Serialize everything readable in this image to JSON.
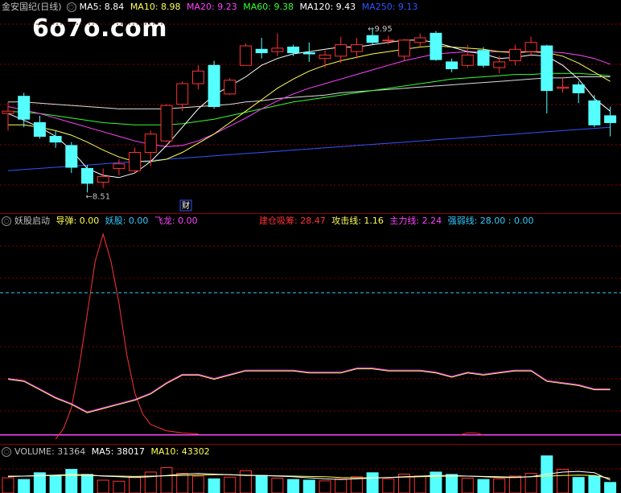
{
  "watermark": "6o7o.com",
  "main_legend": {
    "stock": "金安国纪(日线)",
    "items": [
      {
        "label": "MA5: 8.84",
        "color": "#ffffff"
      },
      {
        "label": "MA10: 8.98",
        "color": "#ffff55"
      },
      {
        "label": "MA20: 9.23",
        "color": "#ff44ff"
      },
      {
        "label": "MA60: 9.38",
        "color": "#33ff33"
      },
      {
        "label": "MA120: 9.43",
        "color": "#ffffff"
      },
      {
        "label": "MA250: 9.13",
        "color": "#3355ff"
      }
    ]
  },
  "annotations": {
    "high": "9.95",
    "low": "8.51",
    "fin": "财"
  },
  "indicator_legend": {
    "name": "妖股启动",
    "items": [
      {
        "label": "导弹: 0.00",
        "color": "#ffff55"
      },
      {
        "label": "妖股: 0.00",
        "color": "#33ccff"
      },
      {
        "label": "飞龙: 0.00",
        "color": "#ff44ff"
      }
    ],
    "items_right": [
      {
        "label": "建仓吸筹: 28.47",
        "color": "#ff3333"
      },
      {
        "label": "攻击线: 1.16",
        "color": "#ffff55"
      },
      {
        "label": "主力线: 2.24",
        "color": "#ff44ff"
      },
      {
        "label": "强弱线: 28.00 : 0.00",
        "color": "#33ccff"
      }
    ]
  },
  "volume_legend": {
    "items": [
      {
        "label": "VOLUME: 31364",
        "color": "#c0c0c0"
      },
      {
        "label": "MA5: 38017",
        "color": "#ffffff"
      },
      {
        "label": "MA10: 43302",
        "color": "#ffff55"
      }
    ]
  },
  "colors": {
    "up": "#ff3333",
    "down": "#55ffff",
    "grid": "#8b0000",
    "ma5": "#ffffff",
    "ma10": "#ffff55",
    "ma20": "#ff44ff",
    "ma60": "#33ff33",
    "ma250": "#3355ff"
  },
  "chart_data": {
    "type": "candlestick",
    "candles": [
      {
        "o": 9.2,
        "h": 9.3,
        "l": 9.05,
        "c": 9.22
      },
      {
        "o": 9.35,
        "h": 9.38,
        "l": 9.08,
        "c": 9.15
      },
      {
        "o": 9.12,
        "h": 9.18,
        "l": 8.98,
        "c": 9.0
      },
      {
        "o": 9.0,
        "h": 9.05,
        "l": 8.9,
        "c": 8.95
      },
      {
        "o": 8.92,
        "h": 8.95,
        "l": 8.68,
        "c": 8.73
      },
      {
        "o": 8.72,
        "h": 8.75,
        "l": 8.51,
        "c": 8.59
      },
      {
        "o": 8.6,
        "h": 8.72,
        "l": 8.55,
        "c": 8.65
      },
      {
        "o": 8.72,
        "h": 8.8,
        "l": 8.66,
        "c": 8.76
      },
      {
        "o": 8.7,
        "h": 8.9,
        "l": 8.68,
        "c": 8.86
      },
      {
        "o": 8.86,
        "h": 9.05,
        "l": 8.74,
        "c": 9.02
      },
      {
        "o": 8.96,
        "h": 9.28,
        "l": 8.95,
        "c": 9.27
      },
      {
        "o": 9.28,
        "h": 9.48,
        "l": 9.22,
        "c": 9.46
      },
      {
        "o": 9.46,
        "h": 9.62,
        "l": 9.41,
        "c": 9.57
      },
      {
        "o": 9.62,
        "h": 9.66,
        "l": 9.24,
        "c": 9.26
      },
      {
        "o": 9.37,
        "h": 9.51,
        "l": 9.36,
        "c": 9.49
      },
      {
        "o": 9.62,
        "h": 9.81,
        "l": 9.62,
        "c": 9.79
      },
      {
        "o": 9.76,
        "h": 9.86,
        "l": 9.68,
        "c": 9.73
      },
      {
        "o": 9.74,
        "h": 9.9,
        "l": 9.7,
        "c": 9.77
      },
      {
        "o": 9.78,
        "h": 9.8,
        "l": 9.7,
        "c": 9.73
      },
      {
        "o": 9.73,
        "h": 9.82,
        "l": 9.65,
        "c": 9.72
      },
      {
        "o": 9.68,
        "h": 9.75,
        "l": 9.6,
        "c": 9.71
      },
      {
        "o": 9.7,
        "h": 9.87,
        "l": 9.64,
        "c": 9.8
      },
      {
        "o": 9.74,
        "h": 9.86,
        "l": 9.68,
        "c": 9.8
      },
      {
        "o": 9.88,
        "h": 9.95,
        "l": 9.8,
        "c": 9.82
      },
      {
        "o": 9.84,
        "h": 9.88,
        "l": 9.8,
        "c": 9.84
      },
      {
        "o": 9.7,
        "h": 9.85,
        "l": 9.66,
        "c": 9.84
      },
      {
        "o": 9.82,
        "h": 9.9,
        "l": 9.78,
        "c": 9.86
      },
      {
        "o": 9.9,
        "h": 9.92,
        "l": 9.66,
        "c": 9.67
      },
      {
        "o": 9.65,
        "h": 9.68,
        "l": 9.56,
        "c": 9.59
      },
      {
        "o": 9.62,
        "h": 9.8,
        "l": 9.6,
        "c": 9.71
      },
      {
        "o": 9.75,
        "h": 9.78,
        "l": 9.6,
        "c": 9.62
      },
      {
        "o": 9.6,
        "h": 9.7,
        "l": 9.55,
        "c": 9.65
      },
      {
        "o": 9.66,
        "h": 9.8,
        "l": 9.62,
        "c": 9.76
      },
      {
        "o": 9.74,
        "h": 9.87,
        "l": 9.7,
        "c": 9.82
      },
      {
        "o": 9.79,
        "h": 9.8,
        "l": 9.2,
        "c": 9.4
      },
      {
        "o": 9.42,
        "h": 9.52,
        "l": 9.38,
        "c": 9.43
      },
      {
        "o": 9.45,
        "h": 9.48,
        "l": 9.29,
        "c": 9.38
      },
      {
        "o": 9.31,
        "h": 9.36,
        "l": 9.08,
        "c": 9.1
      },
      {
        "o": 9.18,
        "h": 9.26,
        "l": 9.0,
        "c": 9.12
      }
    ],
    "ma5": [
      9.2,
      9.14,
      9.08,
      9.0,
      8.88,
      8.72,
      8.66,
      8.64,
      8.68,
      8.78,
      8.92,
      9.08,
      9.24,
      9.36,
      9.44,
      9.52,
      9.62,
      9.68,
      9.72,
      9.74,
      9.76,
      9.78,
      9.78,
      9.8,
      9.82,
      9.84,
      9.84,
      9.82,
      9.78,
      9.74,
      9.72,
      9.68,
      9.69,
      9.71,
      9.7,
      9.62,
      9.5,
      9.33,
      9.22
    ],
    "ma10": [
      9.1,
      9.1,
      9.08,
      9.05,
      9.01,
      8.95,
      8.88,
      8.82,
      8.78,
      8.78,
      8.8,
      8.86,
      8.94,
      9.02,
      9.12,
      9.22,
      9.32,
      9.42,
      9.5,
      9.57,
      9.62,
      9.66,
      9.69,
      9.72,
      9.74,
      9.76,
      9.78,
      9.79,
      9.78,
      9.77,
      9.76,
      9.74,
      9.73,
      9.74,
      9.73,
      9.7,
      9.64,
      9.56,
      9.48
    ],
    "ma20": [
      9.26,
      9.23,
      9.2,
      9.16,
      9.12,
      9.08,
      9.04,
      9.0,
      8.96,
      8.93,
      8.91,
      8.92,
      8.96,
      9.02,
      9.09,
      9.16,
      9.24,
      9.31,
      9.37,
      9.42,
      9.46,
      9.5,
      9.54,
      9.58,
      9.62,
      9.66,
      9.69,
      9.72,
      9.73,
      9.74,
      9.74,
      9.74,
      9.74,
      9.74,
      9.74,
      9.73,
      9.71,
      9.68,
      9.63
    ],
    "ma60": [
      9.22,
      9.21,
      9.2,
      9.18,
      9.16,
      9.14,
      9.12,
      9.11,
      9.1,
      9.1,
      9.1,
      9.11,
      9.13,
      9.15,
      9.18,
      9.21,
      9.24,
      9.27,
      9.3,
      9.32,
      9.34,
      9.36,
      9.38,
      9.4,
      9.42,
      9.44,
      9.46,
      9.48,
      9.5,
      9.51,
      9.52,
      9.53,
      9.54,
      9.54,
      9.55,
      9.55,
      9.55,
      9.54,
      9.53
    ],
    "ma120": [
      9.3,
      9.3,
      9.29,
      9.28,
      9.27,
      9.26,
      9.25,
      9.24,
      9.24,
      9.24,
      9.24,
      9.25,
      9.26,
      9.27,
      9.28,
      9.3,
      9.31,
      9.33,
      9.34,
      9.35,
      9.36,
      9.38,
      9.39,
      9.4,
      9.41,
      9.42,
      9.43,
      9.44,
      9.45,
      9.46,
      9.47,
      9.48,
      9.49,
      9.5,
      9.51,
      9.51,
      9.52,
      9.52,
      9.52
    ],
    "ma250": [
      8.7,
      8.71,
      8.72,
      8.73,
      8.74,
      8.75,
      8.76,
      8.77,
      8.78,
      8.79,
      8.8,
      8.81,
      8.82,
      8.83,
      8.84,
      8.85,
      8.86,
      8.87,
      8.88,
      8.89,
      8.9,
      8.91,
      8.92,
      8.93,
      8.94,
      8.95,
      8.96,
      8.97,
      8.98,
      8.99,
      9.0,
      9.01,
      9.02,
      9.03,
      9.04,
      9.05,
      9.06,
      9.07,
      9.08
    ],
    "price_range": [
      8.4,
      10.05
    ],
    "indicator": {
      "range": [
        0,
        100
      ],
      "reference_level": 70,
      "red_line": [
        2,
        2,
        2,
        2,
        2,
        2,
        2,
        2,
        2,
        2,
        2,
        2,
        2,
        2,
        2,
        2,
        2,
        2,
        2,
        2,
        2,
        2,
        2,
        2,
        2,
        2,
        2,
        2,
        2,
        2,
        2,
        2,
        2,
        2,
        2,
        2,
        2,
        2,
        2
      ],
      "red_spike_x": [
        3.0,
        3.5,
        4.0,
        4.5,
        5.0,
        5.5,
        6.0,
        6.5,
        7.0,
        7.5,
        8.0,
        8.5,
        9.0,
        10.0,
        11.0,
        12.0
      ],
      "red_spike_y": [
        0,
        5,
        15,
        35,
        60,
        85,
        98,
        85,
        65,
        40,
        22,
        12,
        7,
        4,
        3,
        2.5
      ],
      "main_line": [
        29,
        28,
        24,
        20,
        17,
        13,
        15,
        17,
        19,
        22,
        27,
        31,
        31,
        29,
        31,
        33,
        33,
        33,
        33,
        32,
        32,
        32,
        34,
        34,
        33,
        33,
        33,
        32,
        30,
        32,
        31,
        32,
        33,
        33,
        28,
        27,
        26,
        24,
        24
      ]
    },
    "volume": {
      "range": [
        0,
        100000
      ],
      "values": [
        45000,
        40000,
        60000,
        52000,
        70000,
        55000,
        38000,
        35000,
        48000,
        62000,
        75000,
        58000,
        50000,
        42000,
        47000,
        66000,
        52000,
        44000,
        40000,
        38000,
        36000,
        42000,
        48000,
        60000,
        42000,
        56000,
        50000,
        62000,
        55000,
        44000,
        40000,
        42000,
        50000,
        58000,
        110000,
        70000,
        46000,
        50000,
        31364
      ],
      "ma5": [
        48000,
        50000,
        52000,
        53000,
        55000,
        54000,
        50000,
        48000,
        46000,
        48000,
        52000,
        56000,
        58000,
        56000,
        54000,
        52000,
        52000,
        50000,
        48000,
        45000,
        42000,
        40000,
        42000,
        44000,
        46000,
        48000,
        50000,
        52000,
        52000,
        50000,
        48000,
        46000,
        46000,
        48000,
        56000,
        62000,
        64000,
        60000,
        38017
      ],
      "ma10": [
        50000,
        50000,
        51000,
        52000,
        52000,
        52000,
        51000,
        50000,
        49000,
        50000,
        51000,
        52000,
        53000,
        54000,
        54000,
        53000,
        52000,
        51000,
        50000,
        49000,
        48000,
        46000,
        45000,
        45000,
        46000,
        47000,
        48000,
        49000,
        50000,
        50000,
        49000,
        48000,
        47000,
        48000,
        50000,
        52000,
        53000,
        52000,
        43302
      ]
    }
  }
}
